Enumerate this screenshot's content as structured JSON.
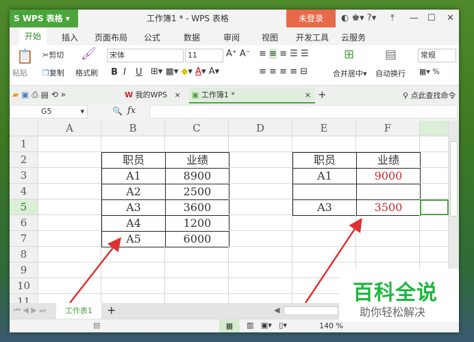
{
  "titlebar": {
    "app": "S WPS 表格",
    "title": "工作簿1 * - WPS 表格",
    "login": "未登录",
    "min": "—",
    "max": "☐",
    "close": "✕"
  },
  "menu_tabs": [
    "开始",
    "插入",
    "页面布局",
    "公式",
    "数据",
    "审阅",
    "视图",
    "开发工具",
    "云服务"
  ],
  "ribbon": {
    "paste": "粘贴",
    "cut": "剪切",
    "copy": "复制",
    "format_painter": "格式刷",
    "font": "宋体",
    "font_size": "11",
    "bold": "B",
    "italic": "I",
    "underline": "U",
    "merge": "合并居中",
    "wrap": "自动换行",
    "number_format": "常规",
    "percent": "%"
  },
  "doctabs": {
    "my_wps": "我的WPS",
    "workbook": "工作簿1 *",
    "search": "点此查找命令"
  },
  "formula": {
    "name_box": "G5",
    "fx": "fx",
    "value": ""
  },
  "columns": [
    "A",
    "B",
    "C",
    "D",
    "E",
    "F",
    ""
  ],
  "rows": [
    "1",
    "2",
    "3",
    "4",
    "5",
    "6",
    "7",
    "8",
    "9",
    "10",
    "11"
  ],
  "selected": {
    "column": "G",
    "row": "5"
  },
  "cells": {
    "B2": "职员",
    "C2": "业绩",
    "B3": "A1",
    "C3": "8900",
    "B4": "A2",
    "C4": "2500",
    "B5": "A3",
    "C5": "3600",
    "B6": "A4",
    "C6": "1200",
    "B7": "A5",
    "C7": "6000",
    "E2": "职员",
    "F2": "业绩",
    "E3": "A1",
    "F3": "9000",
    "E5": "A3",
    "F5": "3500"
  },
  "red_cells": [
    "F3",
    "F5"
  ],
  "sheets": {
    "active": "工作表1",
    "add": "+"
  },
  "status": {
    "zoom": "140 %"
  },
  "watermark": {
    "title": "百科全说",
    "subtitle": "助你轻松解决"
  },
  "colors": {
    "accent": "#4aa53a",
    "login": "#e8694a",
    "red_text": "#d0262c",
    "arrow": "#e03030",
    "watermark": "#1db83f"
  }
}
